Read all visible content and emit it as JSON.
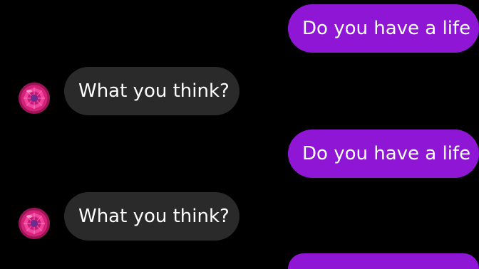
{
  "colors": {
    "background": "#000000",
    "sent_bubble": "#8f16d4",
    "received_bubble": "#2a2a2a",
    "text": "#ffffff"
  },
  "messages": [
    {
      "direction": "sent",
      "text": "Do you have a life"
    },
    {
      "direction": "received",
      "text": "What you think?",
      "avatar": "pink-gem-icon"
    },
    {
      "direction": "sent",
      "text": "Do you have a life"
    },
    {
      "direction": "received",
      "text": "What you think?",
      "avatar": "pink-gem-icon"
    },
    {
      "direction": "sent",
      "text": ""
    }
  ]
}
